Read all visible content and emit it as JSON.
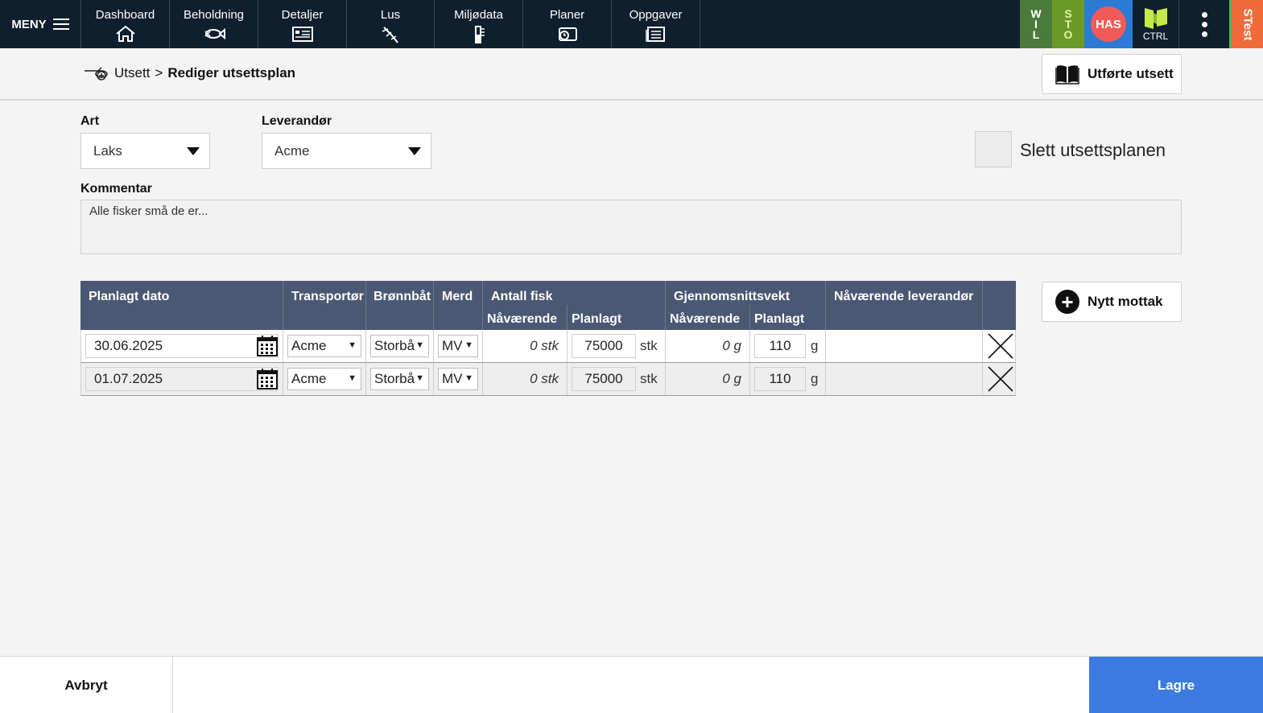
{
  "nav": {
    "menu_label": "MENY",
    "items": [
      {
        "label": "Dashboard",
        "icon": "home-icon"
      },
      {
        "label": "Beholdning",
        "icon": "fish-icon"
      },
      {
        "label": "Detaljer",
        "icon": "details-icon"
      },
      {
        "label": "Lus",
        "icon": "lice-icon"
      },
      {
        "label": "Miljødata",
        "icon": "thermometer-icon"
      },
      {
        "label": "Planer",
        "icon": "plans-icon"
      },
      {
        "label": "Oppgaver",
        "icon": "tasks-icon"
      }
    ],
    "tile_wil": [
      "W",
      "I",
      "L"
    ],
    "tile_sto": [
      "S",
      "T",
      "O"
    ],
    "tile_has": "HAS",
    "tile_ctrl": "CTRL",
    "tile_stest": "STest",
    "colors": {
      "bar": "#0f1f2e",
      "wil": "#4b7a3a",
      "sto": "#6a9a2a",
      "has_bg": "#2a7ad6",
      "has_circle": "#f25a5a",
      "stest": "#f06a3c"
    }
  },
  "breadcrumb": {
    "parent": "Utsett",
    "separator": ">",
    "current": "Rediger utsettsplan"
  },
  "performed_button": "Utførte utsett",
  "form": {
    "art_label": "Art",
    "art_value": "Laks",
    "supplier_label": "Leverandør",
    "supplier_value": "Acme",
    "delete_plan_label": "Slett utsettsplanen",
    "comment_label": "Kommentar",
    "comment_value": "Alle fisker små de er..."
  },
  "table": {
    "headers": {
      "planned_date": "Planlagt dato",
      "transporter": "Transportør",
      "wellboat": "Brønnbåt",
      "pen": "Merd",
      "fish_count": "Antall fisk",
      "fish_current": "Nåværende",
      "fish_planned": "Planlagt",
      "avg_weight": "Gjennomsnittsvekt",
      "weight_current": "Nåværende",
      "weight_planned": "Planlagt",
      "current_supplier": "Nåværende leverandør"
    },
    "rows": [
      {
        "date": "30.06.2025",
        "transporter": "Acme",
        "wellboat": "Storbå",
        "pen": "MV",
        "fish_current": "0 stk",
        "fish_planned": "75000",
        "fish_unit": "stk",
        "weight_current": "0 g",
        "weight_planned": "110",
        "weight_unit": "g",
        "current_supplier": ""
      },
      {
        "date": "01.07.2025",
        "transporter": "Acme",
        "wellboat": "Storbå",
        "pen": "MV",
        "fish_current": "0 stk",
        "fish_planned": "75000",
        "fish_unit": "stk",
        "weight_current": "0 g",
        "weight_planned": "110",
        "weight_unit": "g",
        "current_supplier": ""
      }
    ]
  },
  "new_receipt_button": "Nytt mottak",
  "footer": {
    "cancel": "Avbryt",
    "save": "Lagre",
    "save_color": "#3b7be0"
  }
}
